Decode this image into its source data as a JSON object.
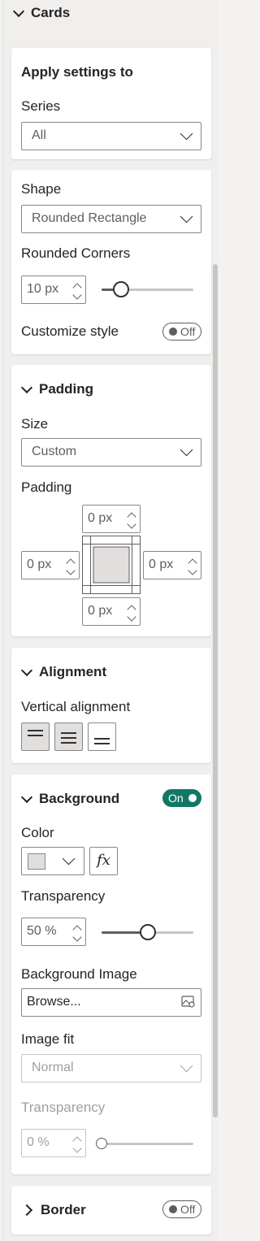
{
  "cards_header": {
    "label": "Cards"
  },
  "apply_settings": {
    "title": "Apply settings to",
    "series_label": "Series",
    "series_value": "All"
  },
  "shape": {
    "label": "Shape",
    "value": "Rounded Rectangle",
    "rounded_corners_label": "Rounded Corners",
    "rounded_corners_value": "10 px",
    "rounded_corners_slider_fraction": 0.2,
    "customize_style_label": "Customize style",
    "customize_style_toggle": "Off"
  },
  "padding": {
    "title": "Padding",
    "size_label": "Size",
    "size_value": "Custom",
    "padding_label": "Padding",
    "top": "0 px",
    "left": "0 px",
    "right": "0 px",
    "bottom": "0 px"
  },
  "alignment": {
    "title": "Alignment",
    "vertical_label": "Vertical alignment",
    "options": [
      "top",
      "middle",
      "bottom"
    ],
    "selected": [
      "top",
      "middle"
    ]
  },
  "background": {
    "title": "Background",
    "toggle": "On",
    "color_label": "Color",
    "swatch_color": "#e1dfdd",
    "fx_label": "fx",
    "transparency_label": "Transparency",
    "transparency_value": "50 %",
    "transparency_slider_fraction": 0.5,
    "image_label": "Background Image",
    "browse_label": "Browse...",
    "image_fit_label": "Image fit",
    "image_fit_value": "Normal",
    "image_transparency_label": "Transparency",
    "image_transparency_value": "0 %",
    "image_transparency_slider_fraction": 0
  },
  "border": {
    "title": "Border",
    "toggle": "Off"
  },
  "colors": {
    "accent_on": "#117865",
    "text": "#252423",
    "disabled": "#a19f9d"
  }
}
